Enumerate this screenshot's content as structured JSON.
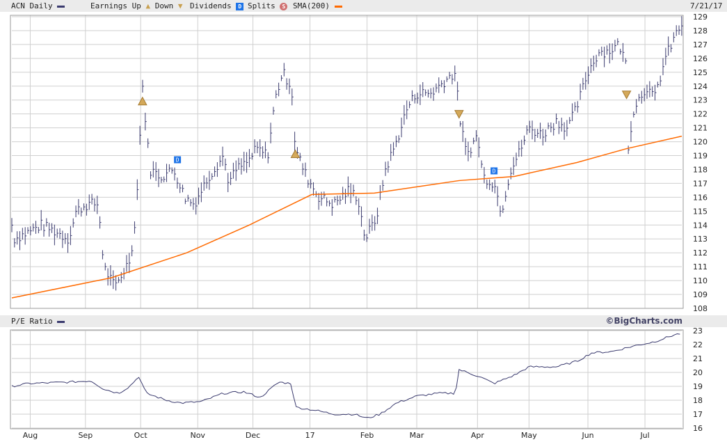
{
  "legend": {
    "title": "ACN Daily",
    "earnings": "Earnings Up",
    "down": "Down",
    "dividends": "Dividends",
    "splits": "Splits",
    "sma": "SMA(200)",
    "date": "7/21/17"
  },
  "pe_panel": {
    "title": "P/E Ratio",
    "copyright": "©BigCharts.com"
  },
  "colors": {
    "price": "#3a3a6e",
    "sma": "#ff6a00",
    "grid": "#cfcfcf"
  },
  "chart_data": [
    {
      "type": "bar",
      "title": "ACN Daily",
      "x_unit": "days since 2016-07-22",
      "ylim": [
        108,
        129
      ],
      "y_ticks": [
        108,
        109,
        110,
        111,
        112,
        113,
        114,
        115,
        116,
        117,
        118,
        119,
        120,
        121,
        122,
        123,
        124,
        125,
        126,
        127,
        128,
        129
      ],
      "x_ticks": [
        {
          "label": "Aug",
          "day": 10
        },
        {
          "label": "Sep",
          "day": 40
        },
        {
          "label": "Oct",
          "day": 70
        },
        {
          "label": "Nov",
          "day": 101
        },
        {
          "label": "Dec",
          "day": 131
        },
        {
          "label": "17",
          "day": 162
        },
        {
          "label": "Feb",
          "day": 193
        },
        {
          "label": "Mar",
          "day": 220
        },
        {
          "label": "Apr",
          "day": 253
        },
        {
          "label": "May",
          "day": 281
        },
        {
          "label": "Jun",
          "day": 313
        },
        {
          "label": "Jul",
          "day": 344
        }
      ],
      "price": [
        [
          0,
          114
        ],
        [
          1,
          113
        ],
        [
          9,
          113.5
        ],
        [
          16,
          114
        ],
        [
          24,
          113.5
        ],
        [
          31,
          113
        ],
        [
          35,
          115
        ],
        [
          41,
          115.5
        ],
        [
          47,
          115.5
        ],
        [
          50,
          111
        ],
        [
          56,
          109.5
        ],
        [
          64,
          111.5
        ],
        [
          67,
          114
        ],
        [
          71,
          124
        ],
        [
          75,
          118
        ],
        [
          81,
          117.5
        ],
        [
          88,
          118
        ],
        [
          94,
          116
        ],
        [
          99,
          115.5
        ],
        [
          107,
          117.5
        ],
        [
          115,
          119
        ],
        [
          118,
          117
        ],
        [
          122,
          118
        ],
        [
          128,
          118.5
        ],
        [
          133,
          119.5
        ],
        [
          139,
          119
        ],
        [
          143,
          123
        ],
        [
          147,
          125
        ],
        [
          152,
          124
        ],
        [
          154,
          119.5
        ],
        [
          160,
          117.5
        ],
        [
          167,
          116
        ],
        [
          175,
          115.5
        ],
        [
          183,
          116.5
        ],
        [
          188,
          116
        ],
        [
          192,
          113
        ],
        [
          198,
          114.5
        ],
        [
          203,
          118
        ],
        [
          209,
          120
        ],
        [
          215,
          122.5
        ],
        [
          220,
          123.5
        ],
        [
          228,
          123.5
        ],
        [
          236,
          124.5
        ],
        [
          241,
          125
        ],
        [
          243,
          122
        ],
        [
          247,
          119
        ],
        [
          253,
          120.5
        ],
        [
          256,
          117.5
        ],
        [
          262,
          117
        ],
        [
          266,
          115
        ],
        [
          271,
          118
        ],
        [
          275,
          119
        ],
        [
          281,
          121
        ],
        [
          288,
          120.5
        ],
        [
          296,
          121.5
        ],
        [
          302,
          121
        ],
        [
          307,
          122.5
        ],
        [
          313,
          125
        ],
        [
          319,
          126.5
        ],
        [
          324,
          126.5
        ],
        [
          330,
          127
        ],
        [
          334,
          125.5
        ],
        [
          335,
          119.5
        ],
        [
          338,
          122.5
        ],
        [
          345,
          124
        ],
        [
          349,
          123
        ],
        [
          355,
          126
        ],
        [
          360,
          127.5
        ],
        [
          364,
          128.5
        ]
      ],
      "sma200": [
        [
          0,
          108.75
        ],
        [
          54,
          110.2
        ],
        [
          95,
          112
        ],
        [
          129,
          114
        ],
        [
          163,
          116.2
        ],
        [
          197,
          116.3
        ],
        [
          243,
          117.2
        ],
        [
          273,
          117.5
        ],
        [
          307,
          118.5
        ],
        [
          334,
          119.5
        ],
        [
          364,
          120.4
        ]
      ],
      "events": [
        {
          "type": "earnings-up",
          "day": 71,
          "value": 122.9
        },
        {
          "type": "earnings-up",
          "day": 154,
          "value": 119.1
        },
        {
          "type": "earnings-down",
          "day": 243,
          "value": 122
        },
        {
          "type": "earnings-down",
          "day": 334,
          "value": 123.4
        },
        {
          "type": "dividend",
          "day": 90,
          "value": 118.7
        },
        {
          "type": "dividend",
          "day": 262,
          "value": 117.9
        }
      ]
    },
    {
      "type": "line",
      "title": "P/E Ratio",
      "ylim": [
        16,
        23
      ],
      "y_ticks": [
        16,
        17,
        18,
        19,
        20,
        21,
        22,
        23
      ],
      "values": [
        [
          0,
          19
        ],
        [
          9,
          19.2
        ],
        [
          31,
          19.3
        ],
        [
          43,
          19.4
        ],
        [
          50,
          18.8
        ],
        [
          58,
          18.5
        ],
        [
          64,
          19
        ],
        [
          69,
          19.7
        ],
        [
          73,
          18.5
        ],
        [
          84,
          18
        ],
        [
          92,
          17.8
        ],
        [
          103,
          17.9
        ],
        [
          115,
          18.5
        ],
        [
          126,
          18.6
        ],
        [
          135,
          18.2
        ],
        [
          145,
          19.3
        ],
        [
          152,
          19.2
        ],
        [
          154,
          17.5
        ],
        [
          164,
          17.3
        ],
        [
          175,
          17
        ],
        [
          186,
          17
        ],
        [
          193,
          16.7
        ],
        [
          200,
          17
        ],
        [
          209,
          17.8
        ],
        [
          220,
          18.3
        ],
        [
          232,
          18.5
        ],
        [
          241,
          18.5
        ],
        [
          243,
          20.2
        ],
        [
          254,
          19.7
        ],
        [
          262,
          19.2
        ],
        [
          273,
          19.8
        ],
        [
          281,
          20.4
        ],
        [
          296,
          20.4
        ],
        [
          307,
          20.8
        ],
        [
          315,
          21.4
        ],
        [
          326,
          21.5
        ],
        [
          338,
          21.9
        ],
        [
          349,
          22.2
        ],
        [
          360,
          22.7
        ],
        [
          364,
          22.8
        ]
      ]
    }
  ]
}
